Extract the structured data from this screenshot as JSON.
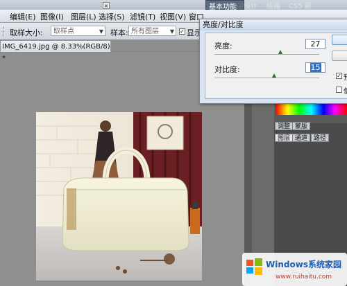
{
  "workspace_tabs": [
    "基本功能",
    "设计",
    "绘画",
    "CS5 新"
  ],
  "menu": [
    "编辑(E)",
    "图像(I)",
    "图层(L)",
    "选择(S)",
    "滤镜(T)",
    "视图(V)",
    "窗口"
  ],
  "options_bar": {
    "sample_size_label": "取样大小:",
    "sample_size_value": "取样点",
    "sample_label": "样本:",
    "sample_value": "所有图层",
    "show_ring_label": "显示"
  },
  "document": {
    "tab_title": "IMG_6419.jpg @ 8.33%(RGB/8) *",
    "close_glyph": "×"
  },
  "dialog": {
    "title": "亮度/对比度",
    "brightness_label": "亮度:",
    "brightness_value": "27",
    "brightness_fraction": 0.63,
    "contrast_label": "对比度:",
    "contrast_value": "15",
    "contrast_fraction": 0.57,
    "preview_label": "预",
    "legacy_label": "使"
  },
  "panels": {
    "adjust_tab": "调整",
    "mask_tab": "蒙版",
    "layers_tab": "图层",
    "channels_tab": "通道",
    "paths_tab": "路径"
  },
  "watermark": {
    "title": "Windows系统家园",
    "url": "www.ruihaitu.com"
  },
  "colors": {
    "dialog_bg": "#d8e4f1",
    "canvas_bg": "#8f8f8f",
    "panel_bg": "#5a5a5a",
    "slider_thumb": "#2f6e2a"
  }
}
